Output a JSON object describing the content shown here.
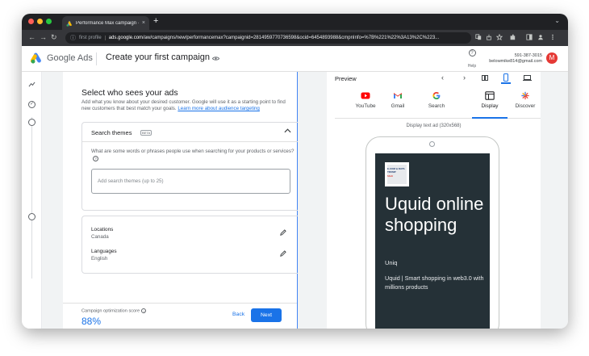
{
  "browser": {
    "tab_title": "Performance Max campaign ·",
    "tab_close": "×",
    "new_tab": "+",
    "tab_menu": "⌄",
    "profile_chip": "first profile",
    "url_host": "ads.google.com",
    "url_path": "/aw/campaigns/new/performancemax?campaignid=2814959770736598&ocid=6454893988&cmpnInfo=%7B%221%22%3A13%2C%223...",
    "back": "←",
    "forward": "→",
    "reload": "↻",
    "lock": "ⓘ"
  },
  "header": {
    "brand": "Google Ads",
    "page_title": "Create your first campaign",
    "help_label": "Help",
    "help_icon": "?",
    "account_phone": "591-387-3015",
    "account_email": "belowmike814@gmail.com",
    "avatar_letter": "M"
  },
  "rail": {
    "step_check": "✓"
  },
  "form": {
    "title": "Select who sees your ads",
    "description": "Add what you know about your desired customer. Google will use it as a starting point to find new customers that best match your goals.",
    "learn_more": "Learn more about audience targeting",
    "themes_title": "Search themes",
    "beta_badge": "BETA",
    "themes_question": "What are some words or phrases people use when searching for your products or services?",
    "themes_help": "?",
    "themes_placeholder": "Add search themes (up to 25)",
    "locations_label": "Locations",
    "locations_value": "Canada",
    "languages_label": "Languages",
    "languages_value": "English",
    "opt_label": "Campaign optimization score",
    "opt_info": "i",
    "opt_score": "88%",
    "back_label": "Back",
    "next_label": "Next"
  },
  "preview": {
    "label": "Preview",
    "prev": "‹",
    "next": "›",
    "subtitle": "Display text ad (320x568)",
    "channels": [
      {
        "label": "YouTube"
      },
      {
        "label": "Gmail"
      },
      {
        "label": "Search"
      },
      {
        "label": "Display"
      },
      {
        "label": "Discover"
      }
    ],
    "ad": {
      "thumb_text": "E-COM & DATA TRUMP",
      "thumb_red": "SALE",
      "headline": "Uquid online shopping",
      "business": "Uniq",
      "description": "Uquid | Smart shopping in web3.0 with millions products"
    }
  },
  "colors": {
    "accent": "#1a73e8",
    "ad_background": "#253137",
    "avatar": "#e53935"
  }
}
